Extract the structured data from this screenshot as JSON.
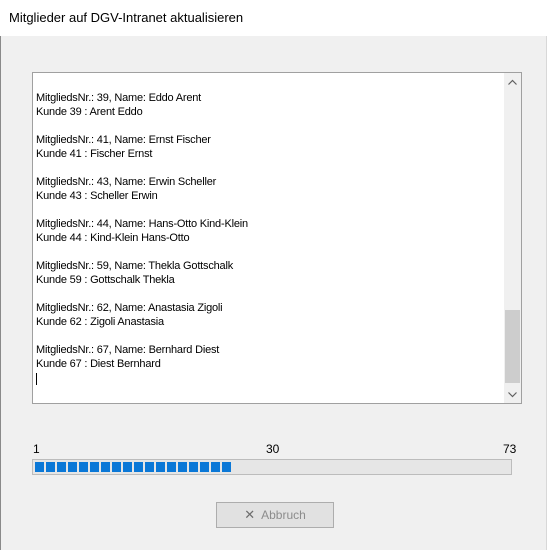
{
  "window": {
    "title": "Mitglieder auf DGV-Intranet aktualisieren"
  },
  "log": {
    "entries": [
      [
        "MitgliedsNr.: 39, Name: Eddo Arent",
        "Kunde 39 : Arent Eddo"
      ],
      [
        "MitgliedsNr.: 41, Name: Ernst Fischer",
        "Kunde 41 : Fischer Ernst"
      ],
      [
        "MitgliedsNr.: 43, Name: Erwin Scheller",
        "Kunde 43 : Scheller Erwin"
      ],
      [
        "MitgliedsNr.: 44, Name: Hans-Otto Kind-Klein",
        "Kunde 44 : Kind-Klein Hans-Otto"
      ],
      [
        "MitgliedsNr.: 59, Name: Thekla Gottschalk",
        "Kunde 59 : Gottschalk Thekla"
      ],
      [
        "MitgliedsNr.: 62, Name: Anastasia Zigoli",
        "Kunde 62 : Zigoli Anastasia"
      ],
      [
        "MitgliedsNr.: 67, Name: Bernhard Diest",
        "Kunde 67 : Diest Bernhard"
      ]
    ],
    "scroll_position": 0.86
  },
  "progress": {
    "min_label": "1",
    "mid_label": "30",
    "max_label": "73",
    "fraction": 0.42,
    "accent_color": "#0b78d7"
  },
  "buttons": {
    "cancel_label": "Abbruch",
    "cancel_icon": "close-icon",
    "cancel_enabled": false
  }
}
